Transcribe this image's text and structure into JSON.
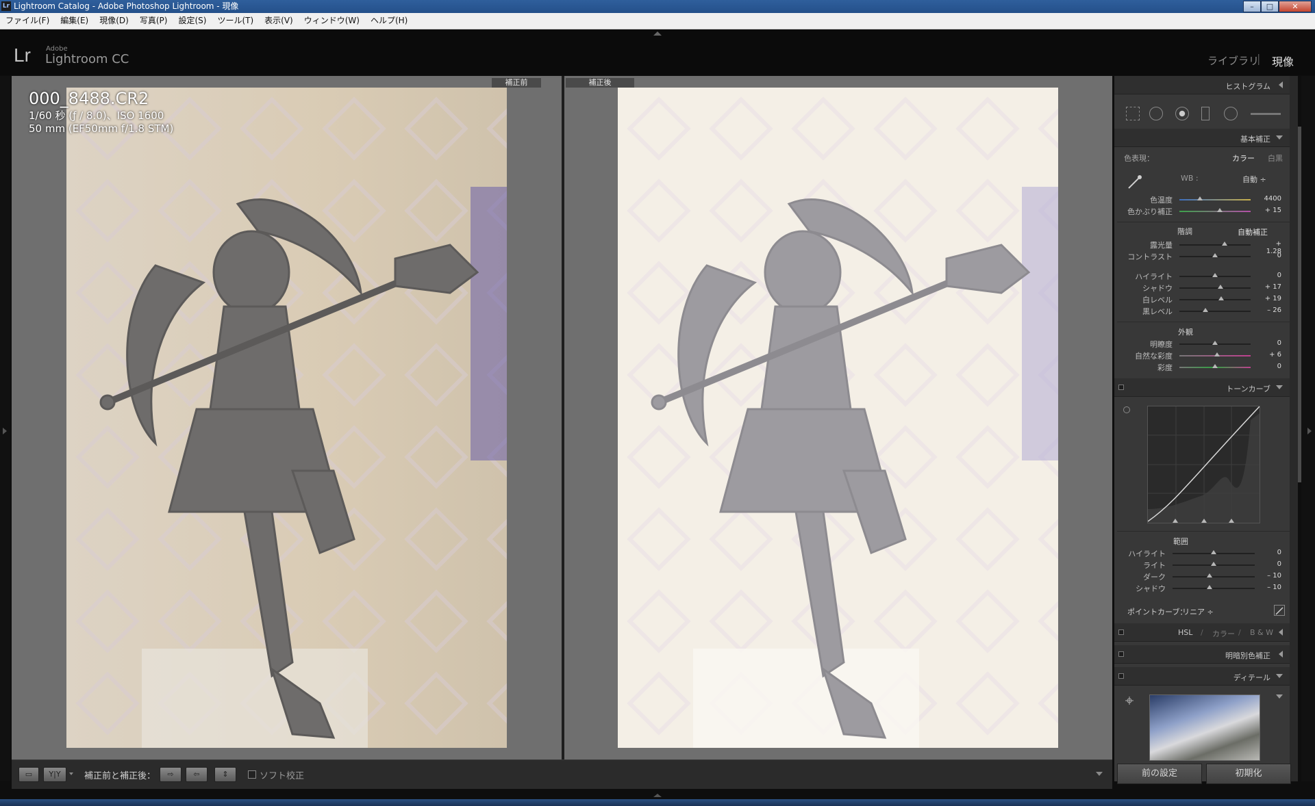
{
  "window": {
    "title": "Lightroom Catalog - Adobe Photoshop Lightroom - 現像",
    "app_icon": "Lr",
    "controls": {
      "minimize": "–",
      "maximize": "□",
      "close": "✕"
    }
  },
  "menu": [
    "ファイル(F)",
    "編集(E)",
    "現像(D)",
    "写真(P)",
    "設定(S)",
    "ツール(T)",
    "表示(V)",
    "ウィンドウ(W)",
    "ヘルプ(H)"
  ],
  "branding": {
    "logo": "Lr",
    "vendor": "Adobe",
    "product": "Lightroom CC"
  },
  "modules": {
    "library": "ライブラリ",
    "separator": "|",
    "develop": "現像"
  },
  "view": {
    "before_tag": "補正前",
    "after_tag": "補正後",
    "filename": "000_8488.CR2",
    "exposure_info": "1/60 秒 (ƒ / 8.0)、ISO 1600",
    "lens_info": "50 mm (EF50mm f/1.8 STM)"
  },
  "toolbar": {
    "view_label": "補正前と補正後：",
    "yy_label": "Y|Y",
    "soft_proof": "ソフト校正"
  },
  "panel": {
    "histogram": {
      "title": "ヒストグラム"
    },
    "basic": {
      "title": "基本補正",
      "treatment_label": "色表現：",
      "treatment_color": "カラー",
      "treatment_bw": "白黒",
      "wb_label": "WB :",
      "wb_value": "自動 ÷",
      "temp": {
        "label": "色温度",
        "value": "4400",
        "pos": 0.28
      },
      "tint": {
        "label": "色かぶり補正",
        "value": "+ 15",
        "pos": 0.56
      },
      "tone_label": "階調",
      "auto_label": "自動補正",
      "exposure": {
        "label": "露光量",
        "value": "+ 1.28",
        "pos": 0.63
      },
      "contrast": {
        "label": "コントラスト",
        "value": "0",
        "pos": 0.5
      },
      "highlights": {
        "label": "ハイライト",
        "value": "0",
        "pos": 0.5
      },
      "shadows": {
        "label": "シャドウ",
        "value": "+ 17",
        "pos": 0.58
      },
      "whites": {
        "label": "白レベル",
        "value": "+ 19",
        "pos": 0.59
      },
      "blacks": {
        "label": "黒レベル",
        "value": "– 26",
        "pos": 0.37
      },
      "presence_label": "外観",
      "clarity": {
        "label": "明瞭度",
        "value": "0",
        "pos": 0.5
      },
      "vibrance": {
        "label": "自然な彩度",
        "value": "+ 6",
        "pos": 0.53
      },
      "saturation": {
        "label": "彩度",
        "value": "0",
        "pos": 0.5
      }
    },
    "tone_curve": {
      "title": "トーンカーブ",
      "region_label": "範囲",
      "highlights": {
        "label": "ハイライト",
        "value": "0",
        "pos": 0.5
      },
      "lights": {
        "label": "ライト",
        "value": "0",
        "pos": 0.5
      },
      "darks": {
        "label": "ダーク",
        "value": "– 10",
        "pos": 0.45
      },
      "shadows": {
        "label": "シャドウ",
        "value": "– 10",
        "pos": 0.45
      },
      "point_curve_label": "ポイントカーブ：",
      "point_curve_value": "リニア ÷"
    },
    "hsl": {
      "hsl": "HSL",
      "sep": "/",
      "color": "カラー",
      "bw": "B & W"
    },
    "split_toning": {
      "title": "明暗別色補正"
    },
    "detail": {
      "title": "ディテール"
    },
    "prev_button": "前の設定",
    "reset_button": "初期化"
  }
}
